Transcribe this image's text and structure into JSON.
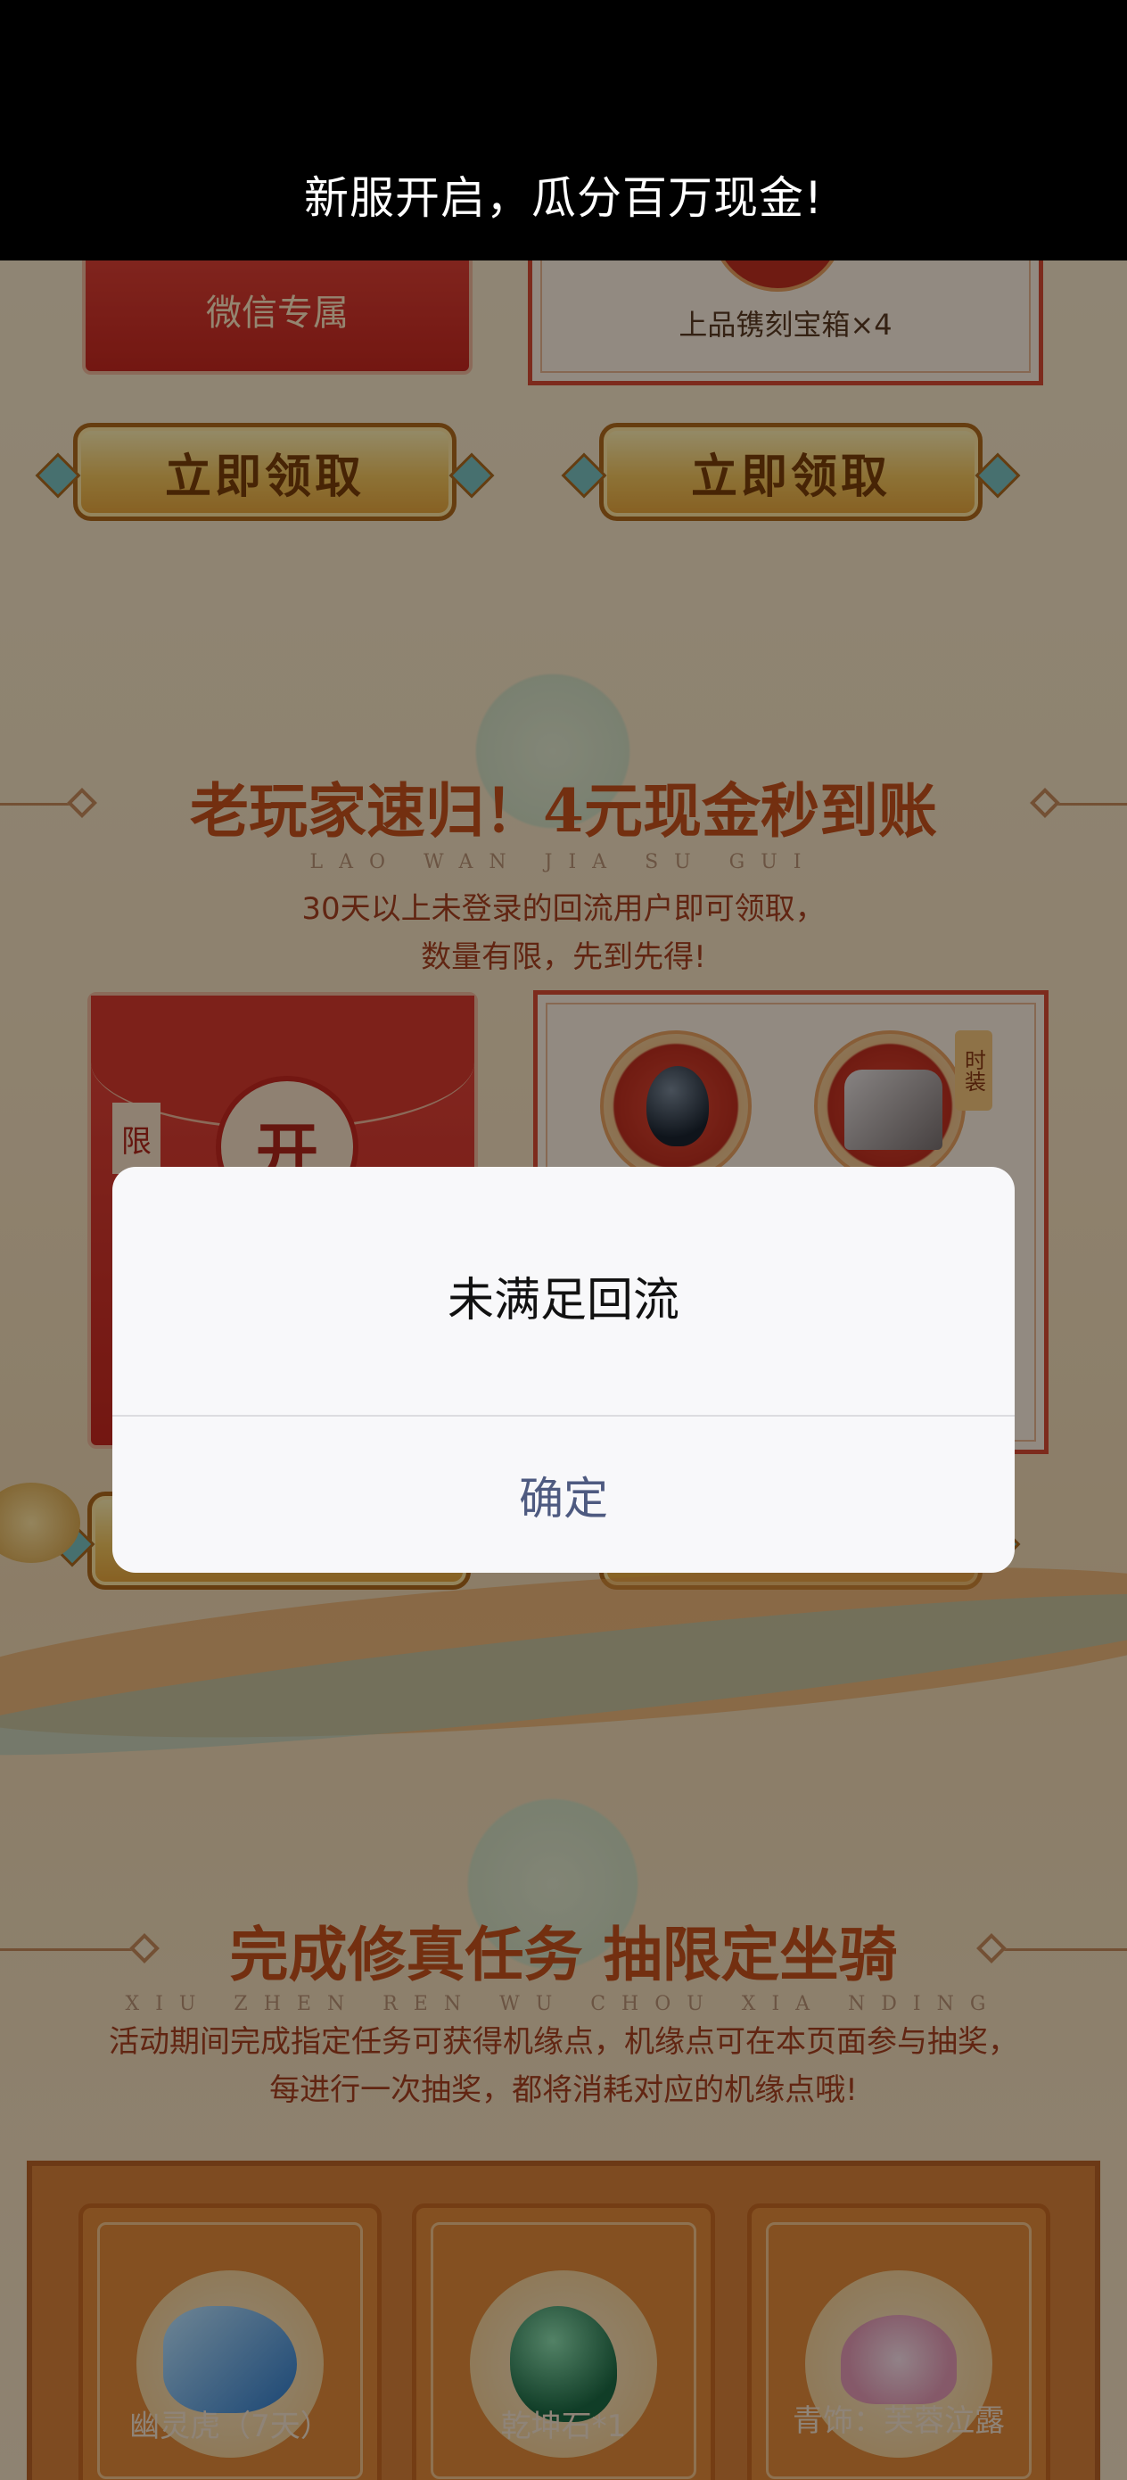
{
  "header": {
    "title": "新服开启，瓜分百万现金!"
  },
  "section_top": {
    "left_card_label": "微信专属",
    "right_card_label": "上品镌刻宝箱×4",
    "claim_left": "立即领取",
    "claim_right": "立即领取"
  },
  "section_return": {
    "title": "老玩家速归！4元现金秒到账",
    "pinyin": "LAO WAN JIA SU GUI",
    "desc_line1": "30天以上未登录的回流用户即可领取，",
    "desc_line2": "数量有限，先到先得!",
    "open_char": "开",
    "side_char": "限",
    "tag_char": "时装"
  },
  "section_mount": {
    "title": "完成修真任务 抽限定坐骑",
    "pinyin": "XIU ZHEN REN WU CHOU XIA NDING",
    "desc_line1": "活动期间完成指定任务可获得机缘点，机缘点可在本页面参与抽奖，",
    "desc_line2": "每进行一次抽奖，都将消耗对应的机缘点哦!",
    "prizes": [
      {
        "label": "幽灵虎（7天）"
      },
      {
        "label": "乾坤石*1"
      },
      {
        "label": "青饰：芙蓉泣露"
      }
    ]
  },
  "dialog": {
    "message": "未满足回流",
    "confirm_label": "确定"
  }
}
